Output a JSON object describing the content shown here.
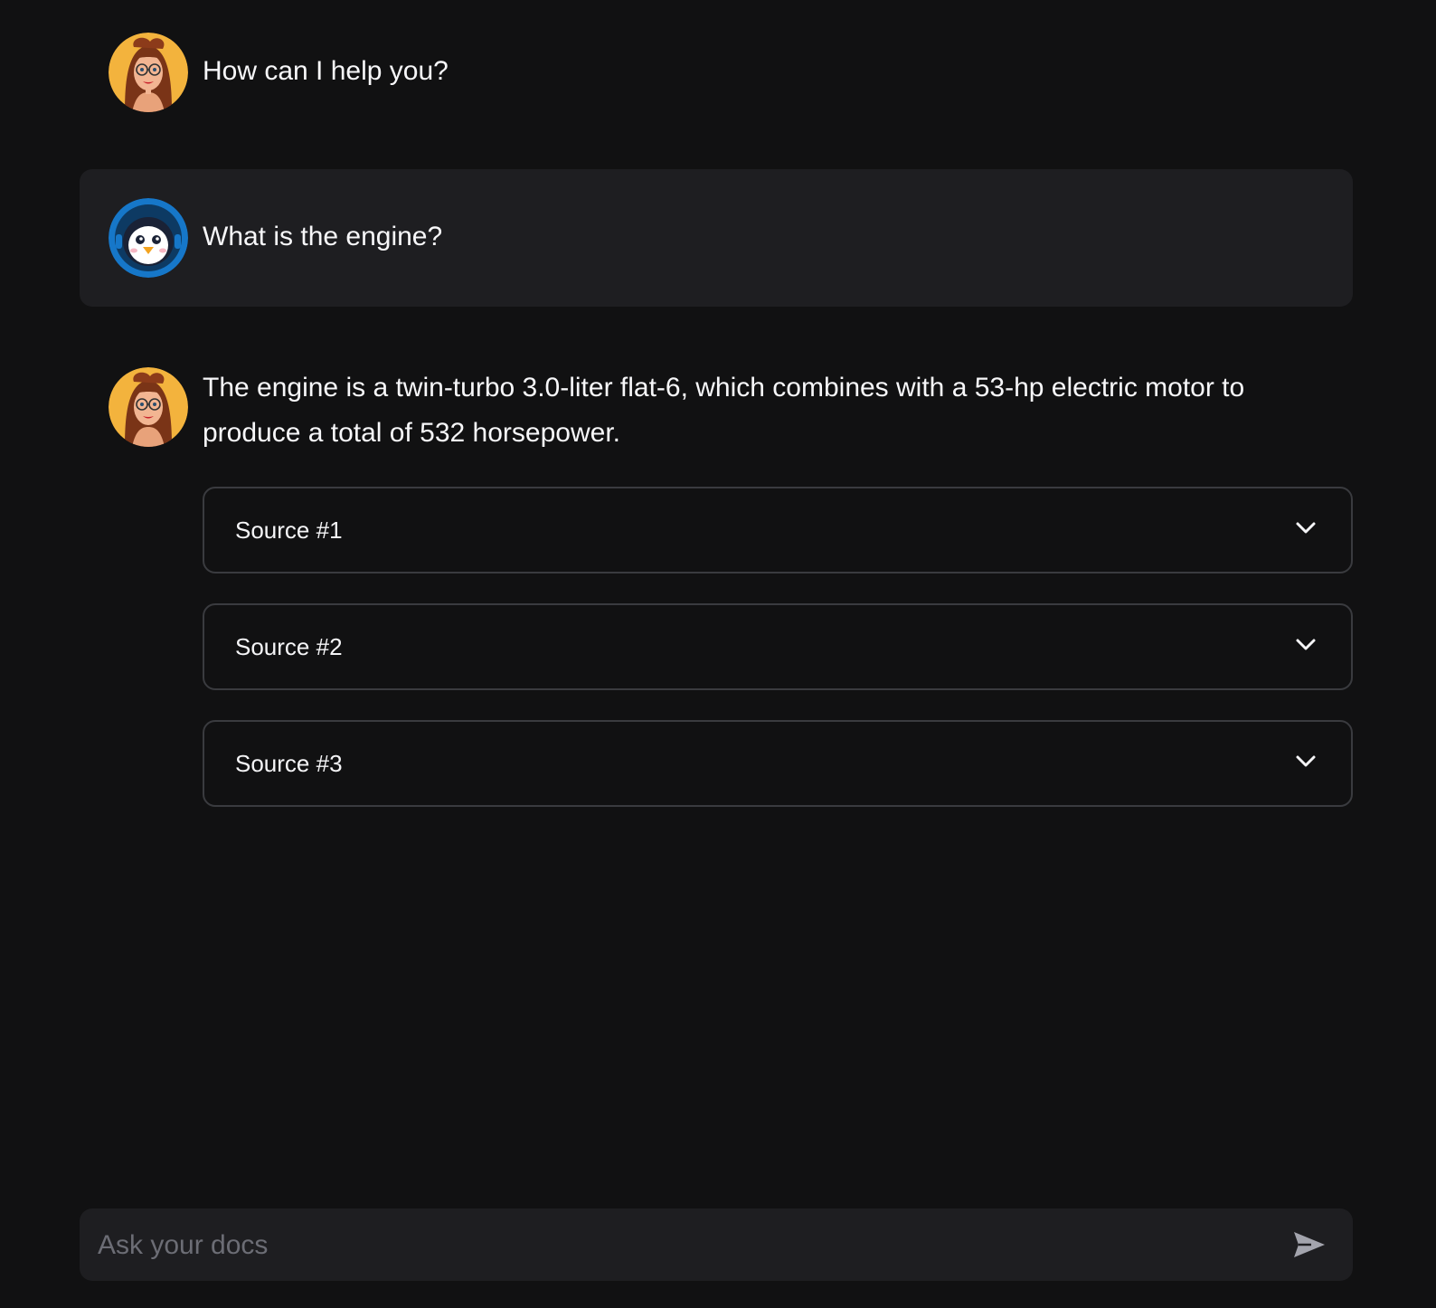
{
  "messages": [
    {
      "role": "assistant",
      "avatar": "woman-avatar-icon",
      "text": "How can I help you?"
    },
    {
      "role": "user",
      "avatar": "penguin-avatar-icon",
      "text": "What is the engine?"
    },
    {
      "role": "assistant",
      "avatar": "woman-avatar-icon",
      "text": "The engine is a twin-turbo 3.0-liter flat-6, which combines with a 53-hp electric motor to produce a total of 532 horsepower."
    }
  ],
  "sources": [
    {
      "label": "Source #1",
      "icon": "chevron-down-icon"
    },
    {
      "label": "Source #2",
      "icon": "chevron-down-icon"
    },
    {
      "label": "Source #3",
      "icon": "chevron-down-icon"
    }
  ],
  "chat_input": {
    "placeholder": "Ask your docs",
    "value": "",
    "send_icon": "send-icon"
  },
  "colors": {
    "background": "#111112",
    "user_bubble": "#1e1e21",
    "assistant_avatar_bg": "#f3b33d",
    "user_avatar_ring": "#1677c9"
  }
}
